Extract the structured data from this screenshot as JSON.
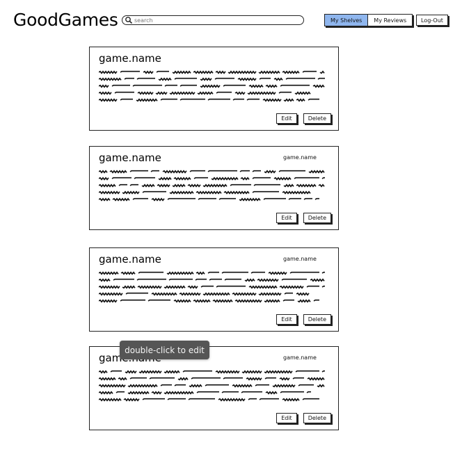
{
  "header": {
    "logo": "GoodGames",
    "search_placeholder": "search",
    "nav": [
      {
        "label": "My Shelves",
        "active": true
      },
      {
        "label": "My Reviews",
        "active": false
      }
    ],
    "logout_label": "Log-Out"
  },
  "cards": [
    {
      "title": "game.name",
      "subtitle": "",
      "edit_label": "Edit",
      "delete_label": "Delete"
    },
    {
      "title": "game.name",
      "subtitle": "game.name",
      "edit_label": "Edit",
      "delete_label": "Delete"
    },
    {
      "title": "game.name",
      "subtitle": "game.name",
      "edit_label": "Edit",
      "delete_label": "Delete"
    },
    {
      "title": "game.name",
      "subtitle": "game.name",
      "edit_label": "Edit",
      "delete_label": "Delete"
    }
  ],
  "tooltip": {
    "text": "double-click to edit"
  },
  "colors": {
    "active_tab": "#8fb6ee",
    "tooltip_bg": "#555555"
  }
}
